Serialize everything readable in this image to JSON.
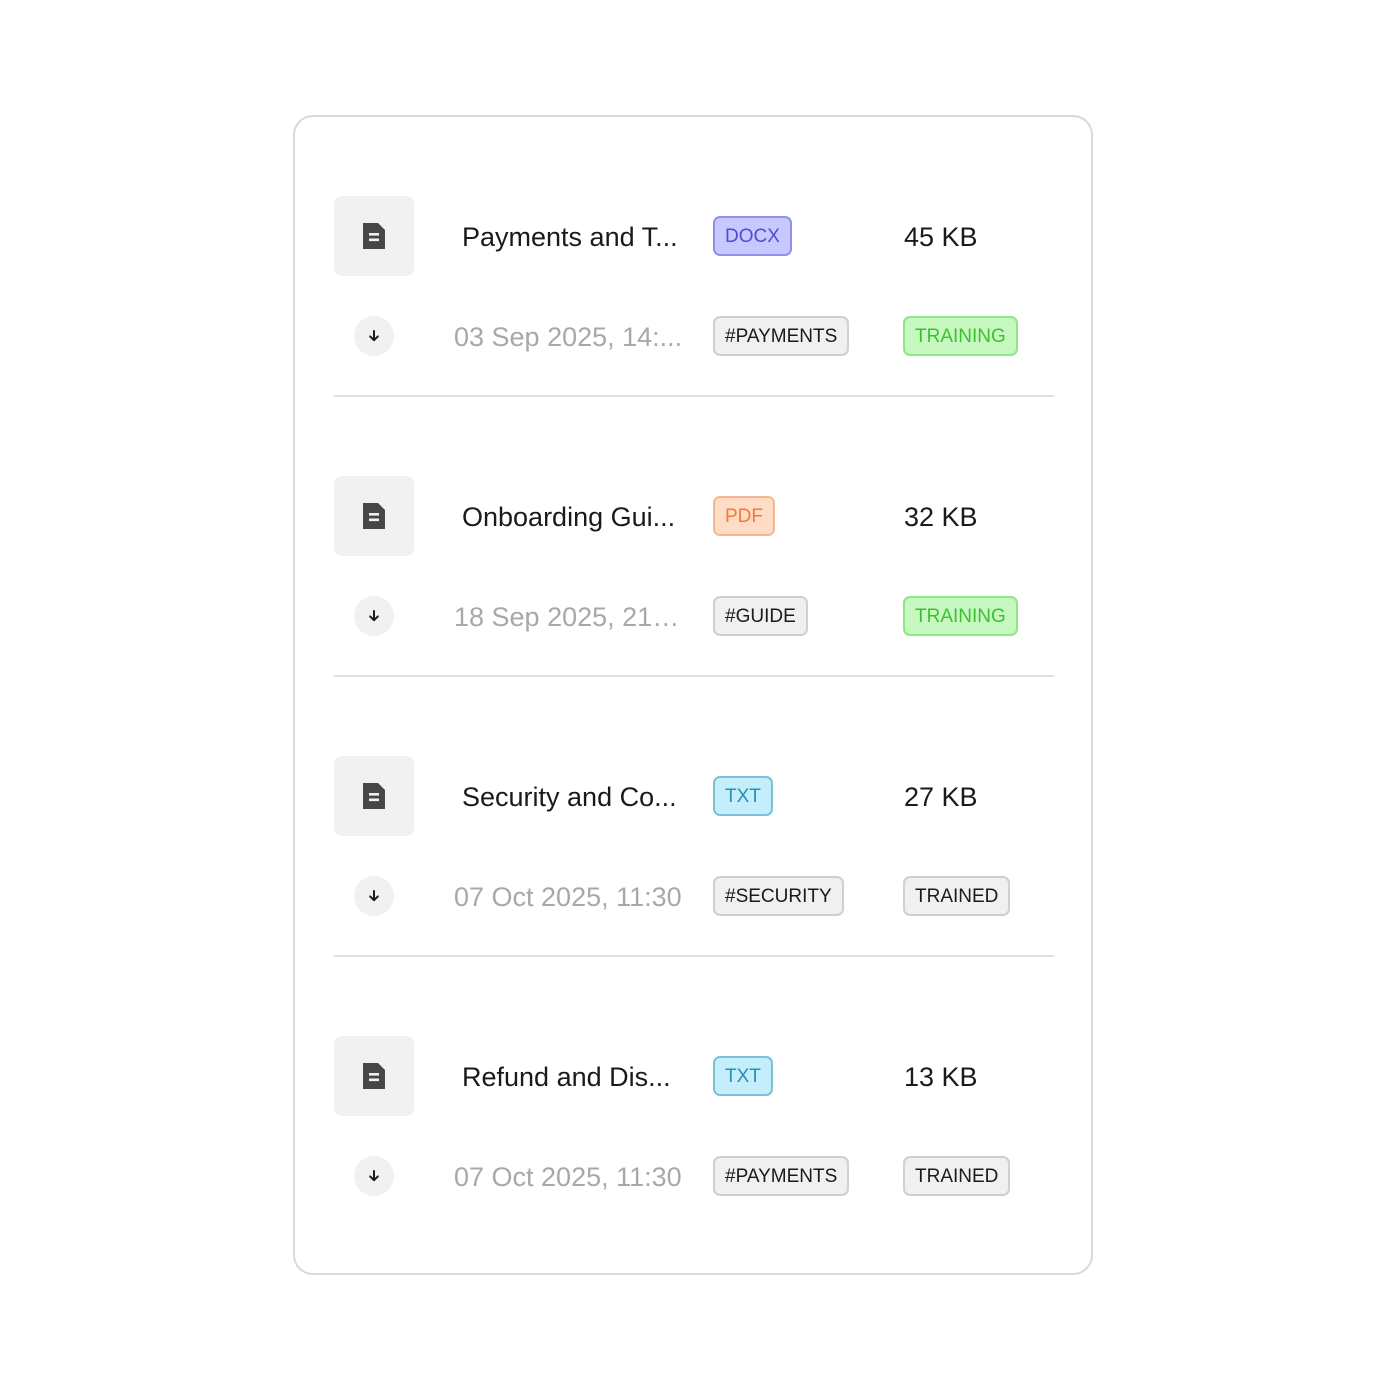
{
  "files": [
    {
      "name": "Payments and T...",
      "date": "03 Sep 2025, 14:...",
      "type": "DOCX",
      "type_colors": {
        "bg": "#c7c8ff",
        "border": "#8f90ea",
        "text": "#4a4fd6"
      },
      "tag": "#PAYMENTS",
      "size": "45 KB",
      "status": "TRAINING",
      "status_colors": {
        "bg": "#c6f8c0",
        "border": "#8ee685",
        "text": "#3cbf33"
      }
    },
    {
      "name": "Onboarding Gui...",
      "date": "18 Sep 2025, 21:0...",
      "type": "PDF",
      "type_colors": {
        "bg": "#ffdcc6",
        "border": "#f2b895",
        "text": "#f07a3a"
      },
      "tag": "#GUIDE",
      "size": "32 KB",
      "status": "TRAINING",
      "status_colors": {
        "bg": "#c6f8c0",
        "border": "#8ee685",
        "text": "#3cbf33"
      }
    },
    {
      "name": "Security and Co...",
      "date": "07 Oct 2025, 11:30",
      "type": "TXT",
      "type_colors": {
        "bg": "#c4eefb",
        "border": "#7cbfd6",
        "text": "#2b8fae"
      },
      "tag": "#SECURITY",
      "size": "27 KB",
      "status": "TRAINED",
      "status_colors": {
        "bg": "#f0f0f0",
        "border": "#d0d0d0",
        "text": "#1a1a1a"
      }
    },
    {
      "name": "Refund and Dis...",
      "date": "07 Oct 2025, 11:30",
      "type": "TXT",
      "type_colors": {
        "bg": "#c4eefb",
        "border": "#7cbfd6",
        "text": "#2b8fae"
      },
      "tag": "#PAYMENTS",
      "size": "13 KB",
      "status": "TRAINED",
      "status_colors": {
        "bg": "#f0f0f0",
        "border": "#d0d0d0",
        "text": "#1a1a1a"
      }
    }
  ],
  "icons": {
    "file": "document-icon",
    "download": "download-arrow-icon"
  }
}
